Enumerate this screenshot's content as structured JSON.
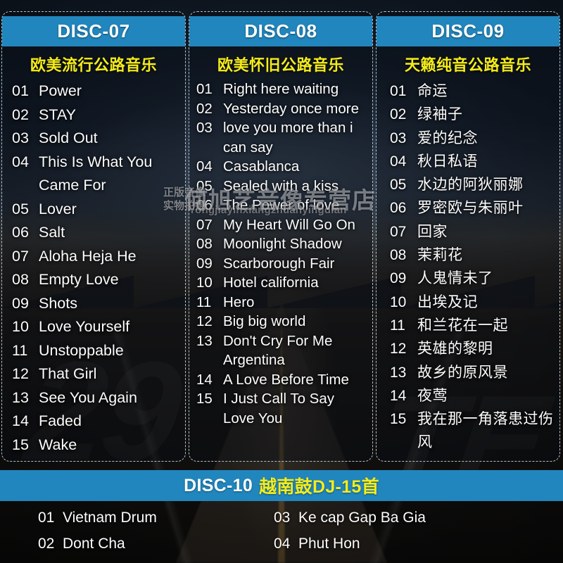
{
  "watermark": {
    "small_line1": "正版音像",
    "small_line2": "实物拍摄",
    "big": "何旭艺音像专营店",
    "pinyin": "Yongjiayinxiangzhuanyingdian"
  },
  "discs": [
    {
      "id": "DISC-07",
      "subtitle": "欧美流行公路音乐",
      "tracks": [
        {
          "num": "01",
          "title": "Power"
        },
        {
          "num": "02",
          "title": "STAY"
        },
        {
          "num": "03",
          "title": "Sold Out"
        },
        {
          "num": "04",
          "title": "This Is What You Came For"
        },
        {
          "num": "05",
          "title": "Lover"
        },
        {
          "num": "06",
          "title": "Salt"
        },
        {
          "num": "07",
          "title": "Aloha Heja He"
        },
        {
          "num": "08",
          "title": "Empty Love"
        },
        {
          "num": "09",
          "title": "Shots"
        },
        {
          "num": "10",
          "title": "Love Yourself"
        },
        {
          "num": "11",
          "title": "Unstoppable"
        },
        {
          "num": "12",
          "title": "That Girl"
        },
        {
          "num": "13",
          "title": "See You Again"
        },
        {
          "num": "14",
          "title": "Faded"
        },
        {
          "num": "15",
          "title": "Wake"
        }
      ]
    },
    {
      "id": "DISC-08",
      "subtitle": "欧美怀旧公路音乐",
      "tracks": [
        {
          "num": "01",
          "title": "Right here waiting"
        },
        {
          "num": "02",
          "title": "Yesterday once more"
        },
        {
          "num": "03",
          "title": "love you more than i can say"
        },
        {
          "num": "04",
          "title": "Casablanca"
        },
        {
          "num": "05",
          "title": "Sealed with a kiss"
        },
        {
          "num": "06",
          "title": "The Power of love"
        },
        {
          "num": "07",
          "title": "My Heart Will Go On"
        },
        {
          "num": "08",
          "title": "Moonlight Shadow"
        },
        {
          "num": "09",
          "title": "Scarborough Fair"
        },
        {
          "num": "10",
          "title": "Hotel california"
        },
        {
          "num": "11",
          "title": "Hero"
        },
        {
          "num": "12",
          "title": "Big big world"
        },
        {
          "num": "13",
          "title": "Don't Cry For Me Argentina"
        },
        {
          "num": "14",
          "title": "A Love Before Time"
        },
        {
          "num": "15",
          "title": "I Just Call To Say Love You"
        }
      ]
    },
    {
      "id": "DISC-09",
      "subtitle": "天籁纯音公路音乐",
      "tracks": [
        {
          "num": "01",
          "title": "命运"
        },
        {
          "num": "02",
          "title": "绿袖子"
        },
        {
          "num": "03",
          "title": "爱的纪念"
        },
        {
          "num": "04",
          "title": "秋日私语"
        },
        {
          "num": "05",
          "title": "水边的阿狄丽娜"
        },
        {
          "num": "06",
          "title": "罗密欧与朱丽叶"
        },
        {
          "num": "07",
          "title": "回家"
        },
        {
          "num": "08",
          "title": "茉莉花"
        },
        {
          "num": "09",
          "title": "人鬼情未了"
        },
        {
          "num": "10",
          "title": "出埃及记"
        },
        {
          "num": "11",
          "title": "和兰花在一起"
        },
        {
          "num": "12",
          "title": "英雄的黎明"
        },
        {
          "num": "13",
          "title": "故乡的原风景"
        },
        {
          "num": "14",
          "title": "夜莺"
        },
        {
          "num": "15",
          "title": "我在那一角落患过伤风"
        }
      ]
    }
  ],
  "footer": {
    "id": "DISC-10",
    "subtitle": "越南鼓DJ-15首",
    "tracks": [
      {
        "num": "01",
        "title": "Vietnam Drum"
      },
      {
        "num": "03",
        "title": "Ke cap Gap Ba Gia"
      },
      {
        "num": "02",
        "title": "Dont Cha"
      },
      {
        "num": "04",
        "title": "Phut Hon"
      }
    ]
  },
  "colors": {
    "header_blue": "#2186bd",
    "subtitle_yellow": "#f5ec1b",
    "track_white": "#fdfdfd"
  }
}
